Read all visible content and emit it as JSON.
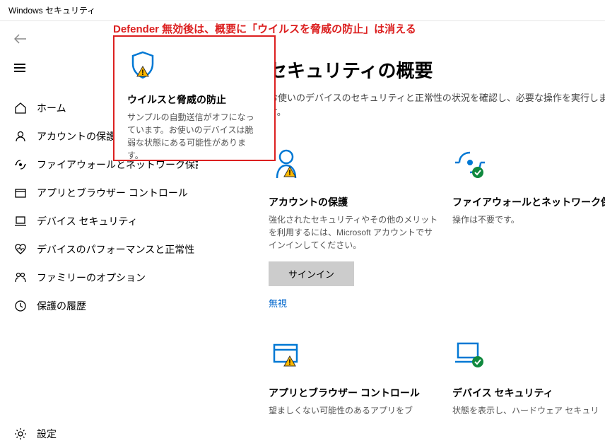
{
  "window_title": "Windows セキュリティ",
  "annotation": "Defender 無効後は、概要に「ウイルスを脅威の防止」は消える",
  "nav": {
    "home": "ホーム",
    "account": "アカウントの保護",
    "firewall": "ファイアウォールとネットワーク保護",
    "app": "アプリとブラウザー コントロール",
    "device": "デバイス セキュリティ",
    "perf": "デバイスのパフォーマンスと正常性",
    "family": "ファミリーのオプション",
    "history": "保護の履歴",
    "settings": "設定"
  },
  "page": {
    "title": "セキュリティの概要",
    "desc": "お使いのデバイスのセキュリティと正常性の状況を確認し、必要な操作を実行します。"
  },
  "callout": {
    "title": "ウイルスと脅威の防止",
    "desc": "サンプルの自動送信がオフになっています。お使いのデバイスは脆弱な状態にある可能性があります。"
  },
  "tiles": {
    "account": {
      "title": "アカウントの保護",
      "desc": "強化されたセキュリティやその他のメリットを利用するには、Microsoft アカウントでサインインしてください。",
      "btn": "サインイン",
      "link": "無視"
    },
    "firewall": {
      "title": "ファイアウォールとネットワーク保護",
      "desc": "操作は不要です。"
    },
    "app": {
      "title": "アプリとブラウザー コントロール",
      "desc": "望ましくない可能性のあるアプリをブ"
    },
    "device": {
      "title": "デバイス セキュリティ",
      "desc": "状態を表示し、ハードウェア セキュリ"
    }
  }
}
